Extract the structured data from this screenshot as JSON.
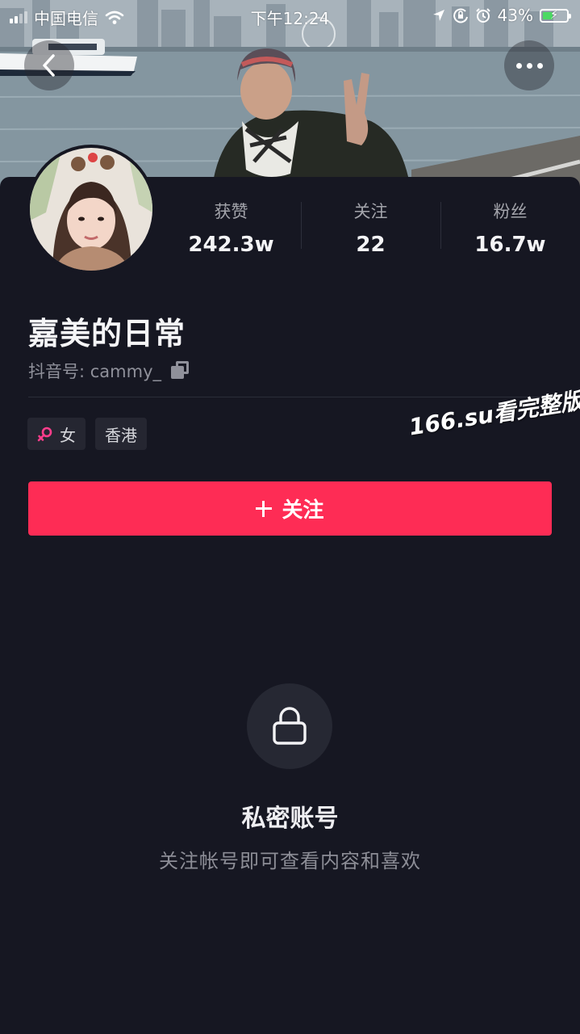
{
  "status_bar": {
    "carrier": "中国电信",
    "time": "下午12:24",
    "battery": "43%",
    "battery_level": 0.43,
    "icons": [
      "signal-icon",
      "wifi-icon",
      "location-arrow-icon",
      "orientation-lock-icon",
      "alarm-icon",
      "battery-charging-icon"
    ]
  },
  "header": {
    "back_icon": "chevron-left-icon",
    "more_icon": "more-dots-icon"
  },
  "stats": [
    {
      "label": "获赞",
      "value": "242.3w"
    },
    {
      "label": "关注",
      "value": "22"
    },
    {
      "label": "粉丝",
      "value": "16.7w"
    }
  ],
  "profile": {
    "name": "嘉美的日常",
    "id_label": "抖音号: cammy_",
    "tags": [
      {
        "icon": "female-icon",
        "label": "女"
      },
      {
        "label": "香港"
      }
    ]
  },
  "watermark": "166.su看完整版",
  "follow_button": {
    "label": "关注"
  },
  "private": {
    "title": "私密账号",
    "description": "关注帐号即可查看内容和喜欢"
  },
  "colors": {
    "background": "#161722",
    "accent": "#fe2c55",
    "female": "#ff3d8b"
  }
}
